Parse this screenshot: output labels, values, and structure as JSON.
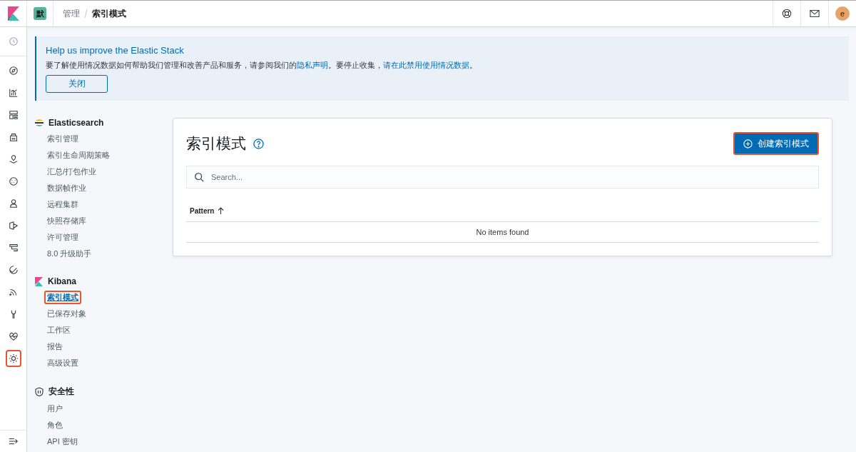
{
  "header": {
    "space_badge": "默",
    "breadcrumbs": [
      "管理",
      "索引模式"
    ],
    "avatar": "e"
  },
  "nav_items": [
    {
      "highlighted": false
    },
    {
      "highlighted": false
    },
    {
      "highlighted": false
    },
    {
      "highlighted": false
    },
    {
      "highlighted": false
    },
    {
      "highlighted": false
    },
    {
      "highlighted": false
    },
    {
      "highlighted": false
    },
    {
      "highlighted": false
    },
    {
      "highlighted": false
    },
    {
      "highlighted": false
    },
    {
      "highlighted": false
    },
    {
      "highlighted": false
    },
    {
      "highlighted": false
    },
    {
      "highlighted": true
    }
  ],
  "banner": {
    "title": "Help us improve the Elastic Stack",
    "text_before": "要了解使用情况数据如何帮助我们管理和改善产品和服务，请参阅我们的",
    "link_1": "隐私声明",
    "text_middle": "。要停止收集，",
    "link_2": "请在此禁用使用情况数据",
    "text_after": "。",
    "button": "关闭"
  },
  "sidebar": {
    "sections": [
      {
        "kind": "elasticsearch",
        "title": "Elasticsearch",
        "items": [
          {
            "label": "索引管理",
            "selected": false,
            "highlighted": false
          },
          {
            "label": "索引生命周期策略",
            "selected": false,
            "highlighted": false
          },
          {
            "label": "汇总/打包作业",
            "selected": false,
            "highlighted": false
          },
          {
            "label": "数据帧作业",
            "selected": false,
            "highlighted": false
          },
          {
            "label": "远程集群",
            "selected": false,
            "highlighted": false
          },
          {
            "label": "快照存储库",
            "selected": false,
            "highlighted": false
          },
          {
            "label": "许可管理",
            "selected": false,
            "highlighted": false
          },
          {
            "label": "8.0 升级助手",
            "selected": false,
            "highlighted": false
          }
        ]
      },
      {
        "kind": "kibana",
        "title": "Kibana",
        "items": [
          {
            "label": "索引模式",
            "selected": true,
            "highlighted": true
          },
          {
            "label": "已保存对象",
            "selected": false,
            "highlighted": false
          },
          {
            "label": "工作区",
            "selected": false,
            "highlighted": false
          },
          {
            "label": "报告",
            "selected": false,
            "highlighted": false
          },
          {
            "label": "高级设置",
            "selected": false,
            "highlighted": false
          }
        ]
      },
      {
        "kind": "security",
        "title": "安全性",
        "items": [
          {
            "label": "用户",
            "selected": false,
            "highlighted": false
          },
          {
            "label": "角色",
            "selected": false,
            "highlighted": false
          },
          {
            "label": "API 密钥",
            "selected": false,
            "highlighted": false
          }
        ]
      }
    ]
  },
  "panel": {
    "title": "索引模式",
    "create_button": {
      "label": "创建索引模式",
      "highlighted": true
    },
    "search": {
      "placeholder": "Search..."
    },
    "table": {
      "columns": [
        {
          "label": "Pattern",
          "sorted": true
        }
      ],
      "empty_message": "No items found"
    }
  }
}
